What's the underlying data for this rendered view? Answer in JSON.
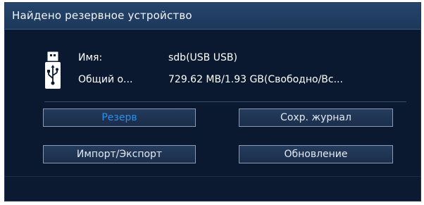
{
  "dialog": {
    "title": "Найдено резервное устройство"
  },
  "device": {
    "icon": "usb-drive-icon",
    "name_label": "Имя:",
    "name_value": "sdb(USB USB)",
    "total_label": "Общий о...",
    "total_value": "729.62 MB/1.93 GB(Свободно/Вс..."
  },
  "buttons": {
    "backup": "Резерв",
    "save_log": "Сохр. журнал",
    "import_export": "Импорт/Экспорт",
    "update": "Обновление"
  },
  "colors": {
    "background": "#0a1930",
    "titlebar": "#1e3a5f",
    "active_text": "#2f8fe6"
  }
}
